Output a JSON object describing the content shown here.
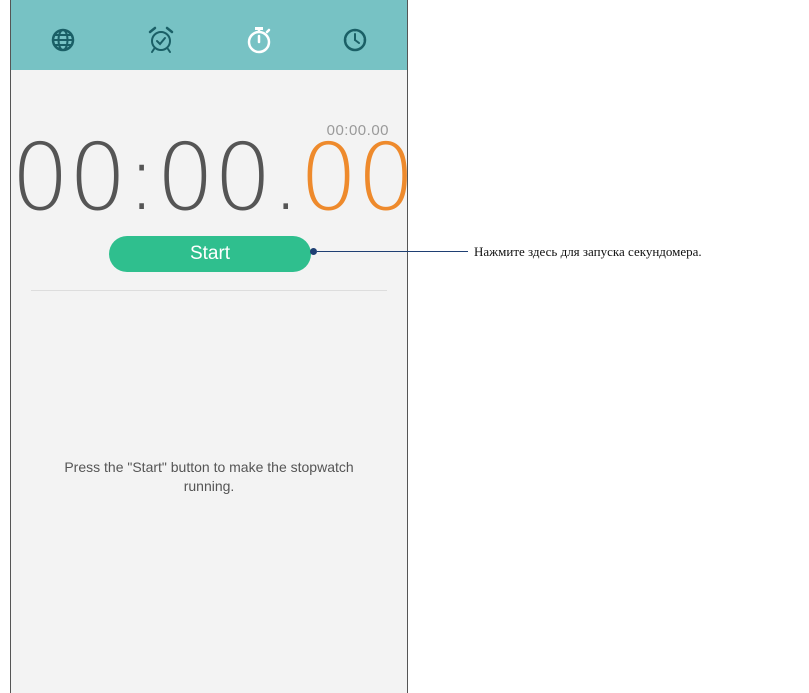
{
  "tabs": [
    {
      "icon": "globe-icon"
    },
    {
      "icon": "alarm-clock-icon"
    },
    {
      "icon": "stopwatch-icon",
      "active": true
    },
    {
      "icon": "timer-icon"
    }
  ],
  "stopwatch": {
    "lap_time": "00:00.00",
    "main_time": "00:00.",
    "hundredths": "00",
    "start_label": "Start",
    "hint": "Press the \"Start\" button to make the stopwatch running."
  },
  "callout": {
    "text": "Нажмите здесь для запуска секундомера."
  },
  "colors": {
    "tabbar": "#77c2c4",
    "start_button": "#2fbf8e",
    "hundredths": "#ee8a2c",
    "callout": "#1f3f73"
  }
}
